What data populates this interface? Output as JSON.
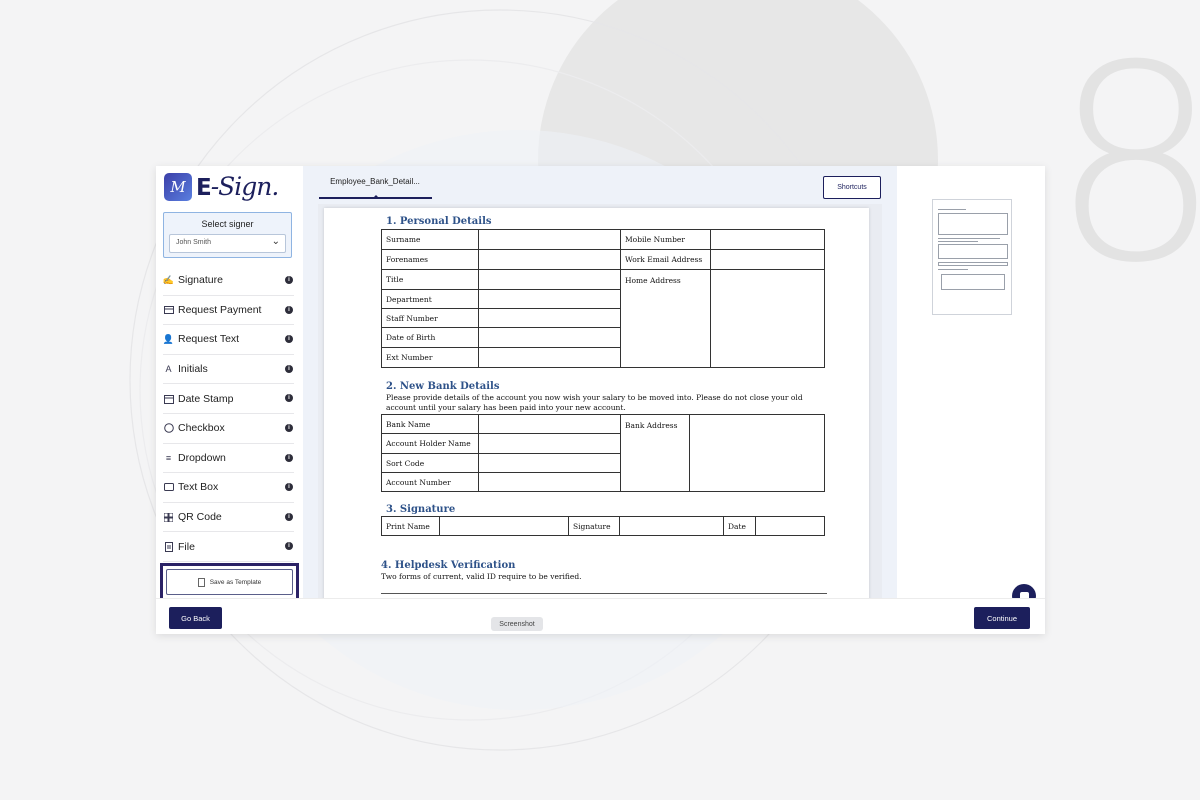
{
  "decor": {
    "digit": "8"
  },
  "logo": {
    "mark": "M",
    "text_e": "E",
    "text_rest": "-Sign."
  },
  "signer": {
    "title": "Select signer",
    "selected": "John Smith"
  },
  "tools": [
    {
      "label": "Signature",
      "icon": "signature-icon"
    },
    {
      "label": "Request Payment",
      "icon": "card-icon"
    },
    {
      "label": "Request Text",
      "icon": "user-text-icon"
    },
    {
      "label": "Initials",
      "icon": "initials-icon"
    },
    {
      "label": "Date Stamp",
      "icon": "calendar-icon"
    },
    {
      "label": "Checkbox",
      "icon": "check-circle-icon"
    },
    {
      "label": "Dropdown",
      "icon": "dropdown-icon"
    },
    {
      "label": "Text Box",
      "icon": "textbox-icon"
    },
    {
      "label": "QR Code",
      "icon": "qr-icon"
    },
    {
      "label": "File",
      "icon": "file-icon"
    }
  ],
  "template_button": "Save as Template",
  "tab": {
    "label": "Employee_Bank_Detail..."
  },
  "shortcuts_label": "Shortcuts",
  "document": {
    "s1": {
      "title": "1. Personal Details",
      "left": [
        "Surname",
        "Forenames",
        "Title",
        "Department",
        "Staff Number",
        "Date of Birth",
        "Ext Number"
      ],
      "right": [
        "Mobile Number",
        "Work Email Address",
        "Home Address"
      ]
    },
    "s2": {
      "title": "2. New Bank Details",
      "desc1": "Please provide details of the account you now wish your salary to be moved into.  Please do not close your old",
      "desc2": "account until your salary has been paid into your new account.",
      "left": [
        "Bank Name",
        "Account Holder Name",
        "Sort Code",
        "Account Number"
      ],
      "right": "Bank Address"
    },
    "s3": {
      "title": "3. Signature",
      "print_name": "Print Name",
      "signature": "Signature",
      "date": "Date"
    },
    "s4": {
      "title": "4. Helpdesk Verification",
      "desc": "Two forms of current, valid ID require to be verified."
    }
  },
  "footer": {
    "go_back": "Go Back",
    "continue": "Continue",
    "screenshot": "Screenshot"
  }
}
